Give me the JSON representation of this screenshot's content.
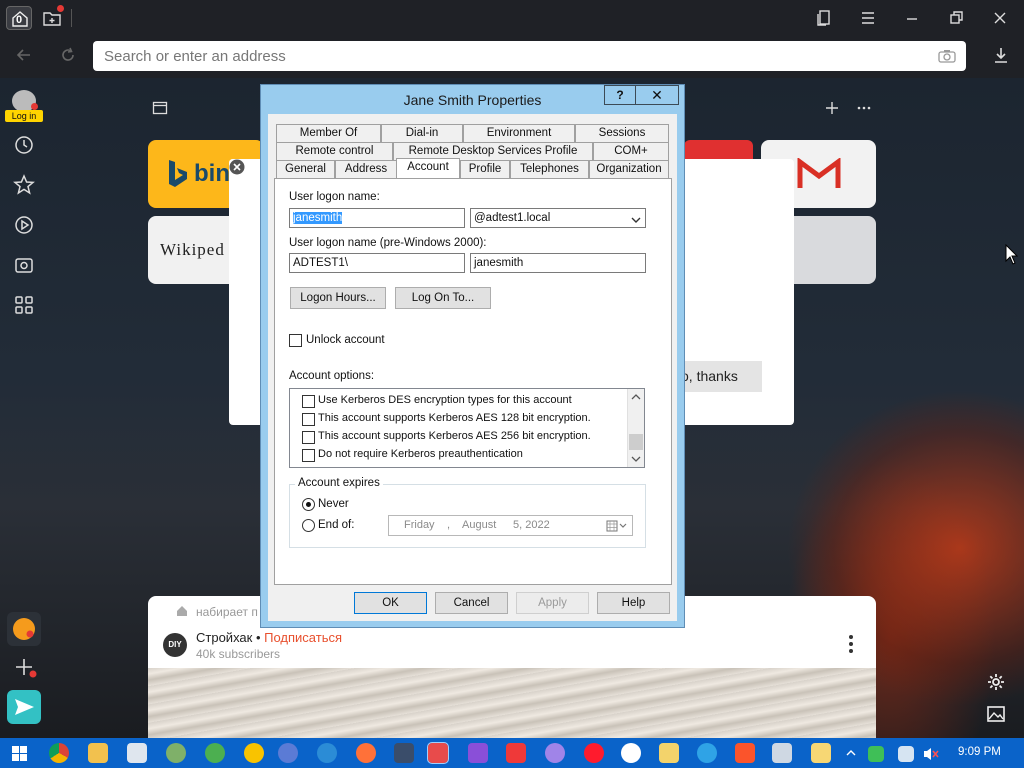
{
  "browser": {
    "home_tab_badge": "0",
    "address_placeholder": "Search or enter an address",
    "login_label": "Log in",
    "tile_bing_text": "bin",
    "tile_wiki_text": "Wikiped",
    "promo_button": "o, thanks"
  },
  "feed": {
    "typing": "набирает п",
    "channel_name": "Стройхак",
    "bullet": " • ",
    "subscribe": "Подписаться",
    "subscribers": "40k subscribers",
    "logo_text": "DIY"
  },
  "dialog": {
    "title": "Jane Smith Properties",
    "help_button": "?",
    "close_button": "✕",
    "tabs_row1": [
      "Member Of",
      "Dial-in",
      "Environment",
      "Sessions"
    ],
    "tabs_row2": [
      "Remote control",
      "Remote Desktop Services Profile",
      "COM+"
    ],
    "tabs_row3": [
      "General",
      "Address",
      "Account",
      "Profile",
      "Telephones",
      "Organization"
    ],
    "active_tab": "Account",
    "user_logon_name_label": "User logon name:",
    "user_logon_name_value": "janesmith",
    "upn_suffix": "@adtest1.local",
    "pre2000_label": "User logon name (pre-Windows 2000):",
    "pre2000_domain": "ADTEST1\\",
    "pre2000_user": "janesmith",
    "logon_hours_button": "Logon Hours...",
    "log_on_to_button": "Log On To...",
    "unlock_account_label": "Unlock account",
    "account_options_label": "Account options:",
    "account_options": [
      "Use Kerberos DES encryption types for this account",
      "This account supports Kerberos AES 128 bit encryption.",
      "This account supports Kerberos AES 256 bit encryption.",
      "Do not require Kerberos preauthentication"
    ],
    "account_expires_label": "Account expires",
    "never_label": "Never",
    "end_of_label": "End of:",
    "date_day": "Friday",
    "date_comma": ",",
    "date_month": "August",
    "date_daynum": "5, 2022",
    "ok_button": "OK",
    "cancel_button": "Cancel",
    "apply_button": "Apply",
    "help_button2": "Help"
  },
  "taskbar": {
    "clock": "9:09 PM"
  },
  "colors": {
    "dialog_frame": "#99ccee",
    "taskbar": "#0a63c9",
    "selection": "#3399ff",
    "bing_tile": "#fdb71a",
    "subscribe": "#e8502e"
  }
}
